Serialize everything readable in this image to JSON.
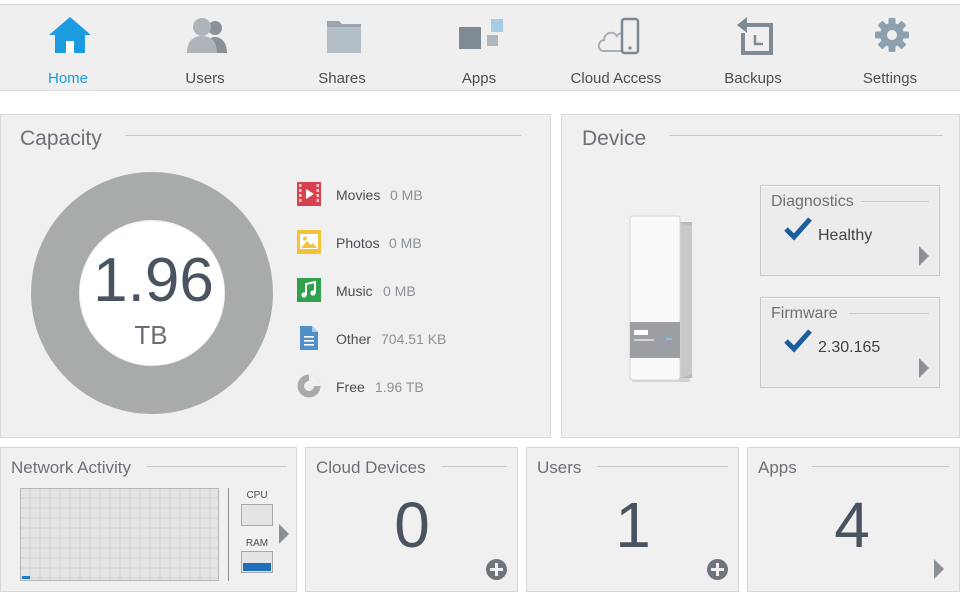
{
  "nav": {
    "items": [
      {
        "label": "Home",
        "icon": "home-icon"
      },
      {
        "label": "Users",
        "icon": "users-icon"
      },
      {
        "label": "Shares",
        "icon": "folder-icon"
      },
      {
        "label": "Apps",
        "icon": "apps-icon"
      },
      {
        "label": "Cloud Access",
        "icon": "cloud-phone-icon"
      },
      {
        "label": "Backups",
        "icon": "backup-icon"
      },
      {
        "label": "Settings",
        "icon": "gear-icon"
      }
    ],
    "active": "Home"
  },
  "capacity": {
    "title": "Capacity",
    "total_value": "1.96",
    "total_unit": "TB",
    "used_fraction": 0,
    "legend": [
      {
        "name": "Movies",
        "value": "0 MB",
        "icon": "movies-icon",
        "color": "#d8424e"
      },
      {
        "name": "Photos",
        "value": "0 MB",
        "icon": "photos-icon",
        "color": "#f2c23a"
      },
      {
        "name": "Music",
        "value": "0 MB",
        "icon": "music-icon",
        "color": "#2fa14d"
      },
      {
        "name": "Other",
        "value": "704.51 KB",
        "icon": "document-icon",
        "color": "#4f90c8"
      },
      {
        "name": "Free",
        "value": "1.96 TB",
        "icon": "free-space-icon",
        "color": "#a7abab"
      }
    ]
  },
  "device": {
    "title": "Device",
    "diagnostics": {
      "title": "Diagnostics",
      "status": "Healthy"
    },
    "firmware": {
      "title": "Firmware",
      "version": "2.30.165"
    }
  },
  "network": {
    "title": "Network Activity",
    "cpu_label": "CPU",
    "ram_label": "RAM",
    "cpu_level": 0.0,
    "ram_level": 0.4
  },
  "cloud_devices": {
    "title": "Cloud Devices",
    "count": "0"
  },
  "users": {
    "title": "Users",
    "count": "1"
  },
  "apps": {
    "title": "Apps",
    "count": "4"
  },
  "colors": {
    "accent": "#1c9be1",
    "panel_bg": "#f0f0f0",
    "text": "#4a4f55",
    "check": "#1d5d9b"
  }
}
